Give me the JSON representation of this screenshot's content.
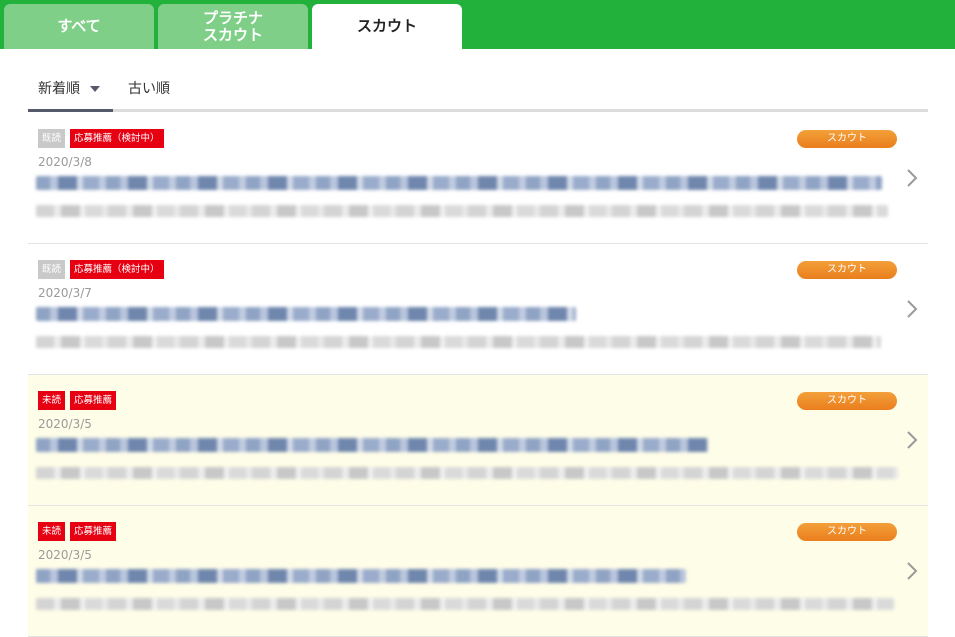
{
  "tabs": [
    {
      "label": "すべて",
      "active": false
    },
    {
      "label": "プラチナ\nスカウト",
      "active": false
    },
    {
      "label": "スカウト",
      "active": true
    }
  ],
  "sort": {
    "options": [
      "新着順",
      "古い順"
    ],
    "selected": "新着順"
  },
  "messages": [
    {
      "read_label": "既読",
      "status_label": "応募推薦（検討中）",
      "category": "スカウト",
      "date": "2020/3/8",
      "unread": false
    },
    {
      "read_label": "既読",
      "status_label": "応募推薦（検討中）",
      "category": "スカウト",
      "date": "2020/3/7",
      "unread": false
    },
    {
      "read_label": "未読",
      "status_label": "応募推薦",
      "category": "スカウト",
      "date": "2020/3/5",
      "unread": true
    },
    {
      "read_label": "未読",
      "status_label": "応募推薦",
      "category": "スカウト",
      "date": "2020/3/5",
      "unread": true
    }
  ],
  "colors": {
    "header_green": "#22b13b",
    "inactive_tab": "#7fcf88",
    "unread_red": "#e60012",
    "scout_orange": "#ee8a26",
    "unread_row_bg": "#fefde8"
  }
}
